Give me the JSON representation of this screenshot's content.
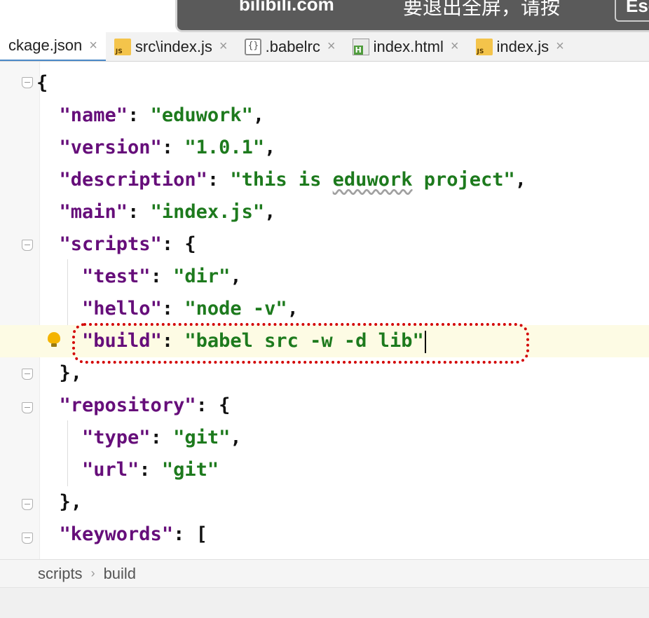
{
  "overlay": {
    "site": "bilibili.com",
    "hint": "要退出全屏，请按",
    "key": "Esc"
  },
  "tabs": [
    {
      "label": "ckage.json",
      "icon": "json-file-icon",
      "active": true
    },
    {
      "label": "src\\index.js",
      "icon": "js-file-icon"
    },
    {
      "label": ".babelrc",
      "icon": "babelrc-file-icon"
    },
    {
      "label": "index.html",
      "icon": "html-file-icon"
    },
    {
      "label": "index.js",
      "icon": "js-file-icon"
    }
  ],
  "tab_close_glyph": "×",
  "code": {
    "l1": "{",
    "l2": {
      "key": "\"name\"",
      "sep": ": ",
      "val": "\"eduwork\"",
      "end": ","
    },
    "l3": {
      "key": "\"version\"",
      "sep": ": ",
      "val": "\"1.0.1\"",
      "end": ","
    },
    "l4": {
      "key": "\"description\"",
      "sep": ": ",
      "val1": "\"this is ",
      "val2": "eduwork",
      "val3": " project\"",
      "end": ","
    },
    "l5": {
      "key": "\"main\"",
      "sep": ": ",
      "val": "\"index.js\"",
      "end": ","
    },
    "l6": {
      "key": "\"scripts\"",
      "sep": ": {"
    },
    "l7": {
      "key": "\"test\"",
      "sep": ": ",
      "val": "\"dir\"",
      "end": ","
    },
    "l8": {
      "key": "\"hello\"",
      "sep": ": ",
      "val": "\"node -v\"",
      "end": ","
    },
    "l9": {
      "key": "\"build\"",
      "sep": ": ",
      "val": "\"babel src -w -d lib\""
    },
    "l10": "},",
    "l11": {
      "key": "\"repository\"",
      "sep": ": {"
    },
    "l12": {
      "key": "\"type\"",
      "sep": ": ",
      "val": "\"git\"",
      "end": ","
    },
    "l13": {
      "key": "\"url\"",
      "sep": ": ",
      "val": "\"git\""
    },
    "l14": "},",
    "l15": {
      "key": "\"keywords\"",
      "sep": ": ["
    }
  },
  "breadcrumb": {
    "items": [
      "scripts",
      "build"
    ],
    "separator": "›"
  },
  "colors": {
    "key": "#660e7a",
    "string": "#1d7a1d",
    "highlight": "#d30000",
    "current_line": "#fdfbe4"
  }
}
